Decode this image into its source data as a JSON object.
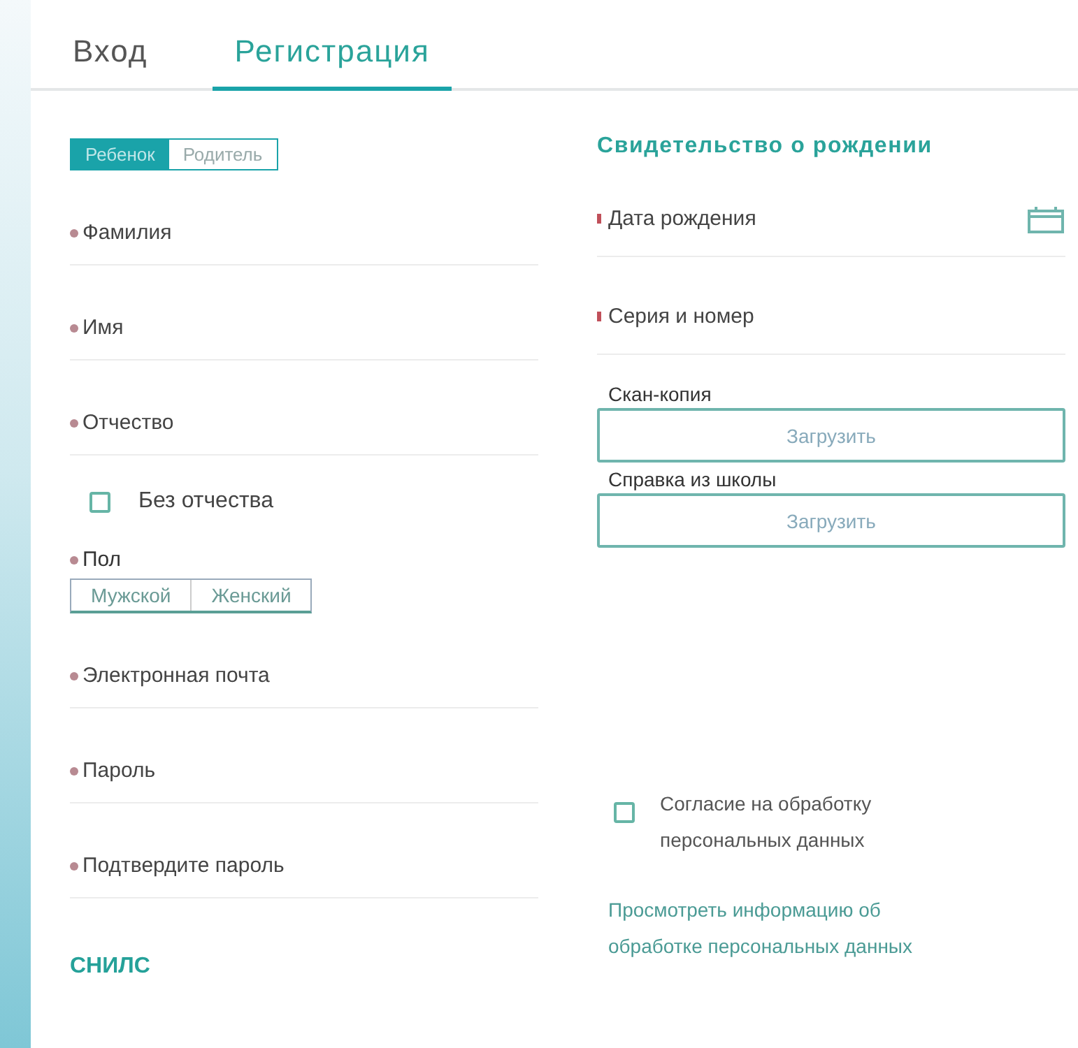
{
  "tabs": [
    {
      "label": "Вход",
      "selected": false
    },
    {
      "label": "Регистрация",
      "selected": true
    }
  ],
  "role_toggle": [
    {
      "label": "Ребенок",
      "selected": true
    },
    {
      "label": "Родитель",
      "selected": false
    }
  ],
  "left_fields": [
    {
      "kind": "input",
      "label": "Фамилия",
      "required": true
    },
    {
      "kind": "input",
      "label": "Имя",
      "required": true
    },
    {
      "kind": "input",
      "label": "Отчество",
      "required": true
    },
    {
      "kind": "checkbox",
      "label": "Без отчества",
      "checked": false
    },
    {
      "kind": "segmented",
      "label": "Пол",
      "required": true,
      "options": [
        {
          "label": "Мужской",
          "selected": false
        },
        {
          "label": "Женский",
          "selected": false
        }
      ]
    },
    {
      "kind": "input",
      "label": "Электронная почта",
      "required": true
    },
    {
      "kind": "input",
      "label": "Пароль",
      "required": true
    },
    {
      "kind": "input",
      "label": "Подтвердите пароль",
      "required": true
    },
    {
      "kind": "heading",
      "label": "СНИЛС"
    }
  ],
  "right_heading": "Свидетельство о рождении",
  "right_fields": [
    {
      "kind": "date",
      "label": "Дата рождения",
      "required": true
    },
    {
      "kind": "input",
      "label": "Серия и номер",
      "required": true
    },
    {
      "kind": "upload",
      "label": "Скан-копия",
      "button": "Загрузить"
    },
    {
      "kind": "upload",
      "label": "Справка из школы",
      "button": "Загрузить"
    }
  ],
  "consent": {
    "label": "Согласие на обработку персональных данных",
    "checked": false
  },
  "info_link": "Просмотреть информацию об обработке персональных данных"
}
